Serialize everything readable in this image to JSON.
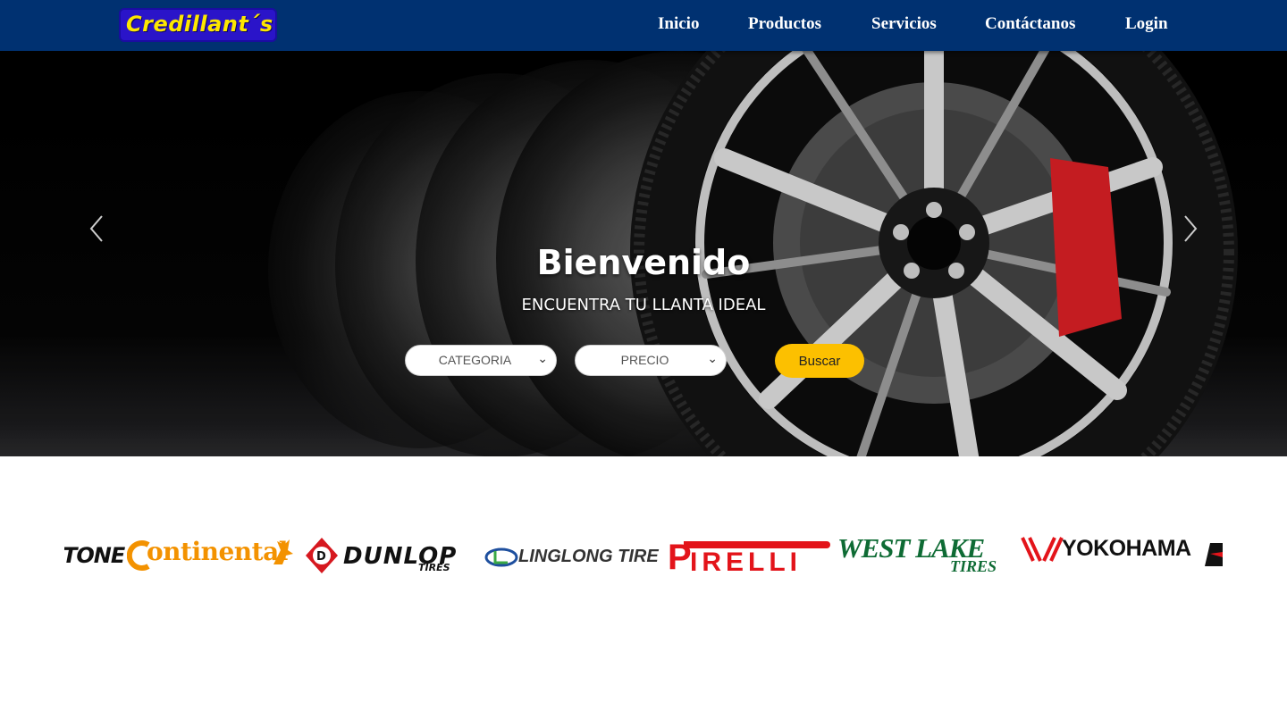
{
  "brand": {
    "logo_text": "Credillant´s"
  },
  "nav": {
    "items": [
      {
        "label": "Inicio"
      },
      {
        "label": "Productos"
      },
      {
        "label": "Servicios"
      },
      {
        "label": "Contáctanos"
      },
      {
        "label": "Login"
      }
    ]
  },
  "hero": {
    "title": "Bienvenido",
    "subtitle": "ENCUENTRA TU LLANTA IDEAL",
    "category_select": "CATEGORIA",
    "price_select": "PRECIO",
    "search_button": "Buscar"
  },
  "brands": {
    "logos": [
      "TONE",
      "ontinental",
      "DUNLOP",
      "TIRES",
      "LINGLONG TIRE",
      "IRELLI",
      "WEST LAKE",
      "TIRES",
      "YOKOHAMA"
    ]
  },
  "colors": {
    "navbar": "#003171",
    "logo_bg": "#2a14c9",
    "logo_text": "#fde700",
    "button": "#fcc000"
  }
}
